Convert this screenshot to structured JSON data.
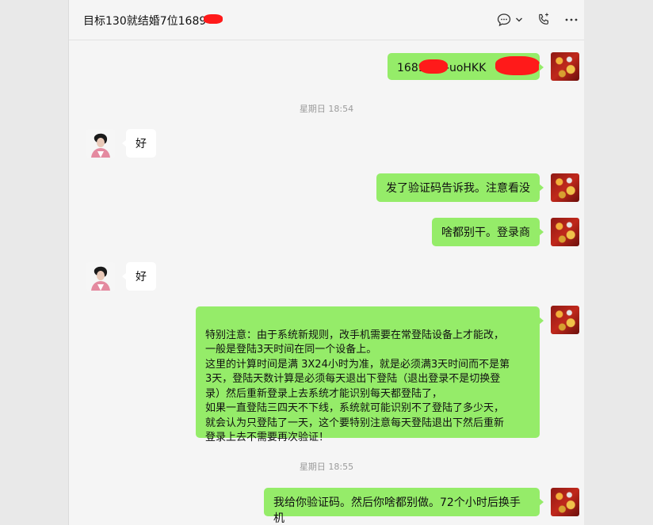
{
  "chat": {
    "title": "目标130就结婚7位1689"
  },
  "header_icons": [
    "chat-bubble-icon",
    "chevron-down-icon",
    "phone-icon",
    "more-icon"
  ],
  "messages": {
    "m1": "1689------uoHKK",
    "t1": "星期日 18:54",
    "m2": "好",
    "m3": "发了验证码告诉我。注意看没",
    "m4": "啥都别干。登录商",
    "m5": "好",
    "m6": "特别注意：由于系统新规则，改手机需要在常登陆设备上才能改，\n一般是登陆3天时间在同一个设备上。\n这里的计算时间是满 3X24小时为准，就是必须满3天时间而不是第\n3天，登陆天数计算是必须每天退出下登陆（退出登录不是切换登\n录）然后重新登录上去系统才能识别每天都登陆了，\n如果一直登陆三四天不下线，系统就可能识别不了登陆了多少天，\n就会认为只登陆了一天，这个要特别注意每天登陆退出下然后重新\n登录上去不需要再次验证！",
    "t2": "星期日 18:55",
    "m7": "我给你验证码。然后你啥都别做。72个小时后换手机"
  },
  "colors": {
    "outgoing_bubble": "#95ec69",
    "incoming_bubble": "#ffffff",
    "accent": "#07c160",
    "redaction": "#ff1a1a"
  }
}
